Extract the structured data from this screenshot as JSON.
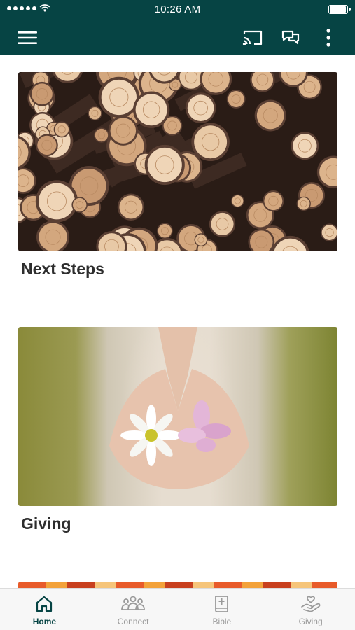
{
  "status_bar": {
    "time": "10:26 AM",
    "battery_level": 0.95
  },
  "app_bar": {
    "background_color": "#064444",
    "icons": [
      "menu-icon",
      "cast-icon",
      "chat-icon",
      "more-vertical-icon"
    ]
  },
  "cards": [
    {
      "title": "Next Steps",
      "image": "cut-logs-photo"
    },
    {
      "title": "Giving",
      "image": "hands-holding-flowers-photo"
    },
    {
      "title": "",
      "image": "orange-pattern-photo"
    }
  ],
  "tab_bar": {
    "active_color": "#064444",
    "inactive_color": "#9a9a9a",
    "tabs": [
      {
        "label": "Home",
        "icon": "home-icon",
        "active": true
      },
      {
        "label": "Connect",
        "icon": "people-icon",
        "active": false
      },
      {
        "label": "Bible",
        "icon": "bible-icon",
        "active": false
      },
      {
        "label": "Giving",
        "icon": "giving-hand-icon",
        "active": false
      }
    ]
  }
}
